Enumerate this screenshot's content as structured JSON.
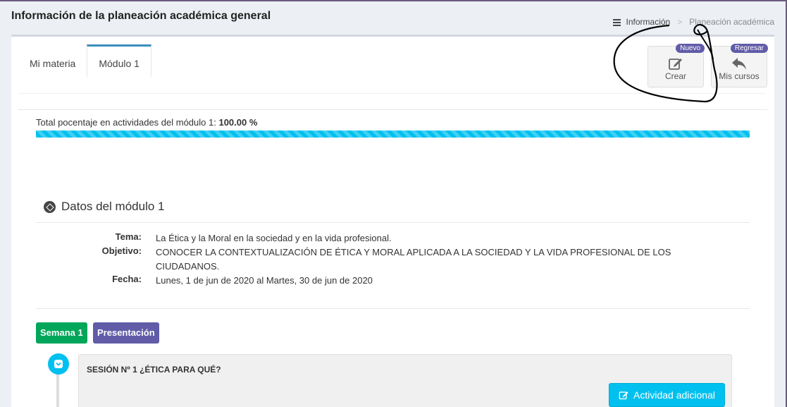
{
  "page": {
    "title": "Información de la planeación académica general"
  },
  "breadcrumb": {
    "items": [
      "Información",
      "Planeación académica"
    ],
    "separator": ">"
  },
  "tabs": [
    {
      "label": "Mi materia"
    },
    {
      "label": "Módulo 1"
    }
  ],
  "toolbar": {
    "create": {
      "label": "Crear",
      "badge": "Nuevo",
      "icon": "edit-icon"
    },
    "back": {
      "label": "Mis cursos",
      "badge": "Regresar",
      "icon": "reply-icon"
    }
  },
  "progress": {
    "label": "Total pocentaje en actividades del módulo 1:",
    "value_text": "100.00 %",
    "value": 1.0
  },
  "module": {
    "section_title": "Datos del módulo 1",
    "fields": {
      "tema_label": "Tema:",
      "tema_value": "La Ética y la Moral en la sociedad y en la vida profesional.",
      "objetivo_label": "Objetivo:",
      "objetivo_value": "CONOCER LA CONTEXTUALIZACIÓN DE ÉTICA Y MORAL APLICADA A LA SOCIEDAD Y LA VIDA PROFESIONAL DE LOS CIUDADANOS.",
      "fecha_label": "Fecha:",
      "fecha_value": "Lunes, 1 de jun de 2020 al Martes, 30 de jun de 2020"
    }
  },
  "timeline": {
    "week_label": "Semana 1",
    "presentation_label": "Presentación",
    "session_title": "SESIÓN Nº 1 ¿ÉTICA PARA QUÉ?",
    "extra_button": "Actividad adicional"
  },
  "colors": {
    "accent": "#3c8dbc",
    "info": "#00c0ef",
    "success": "#00a65a",
    "purple": "#605ca8"
  }
}
